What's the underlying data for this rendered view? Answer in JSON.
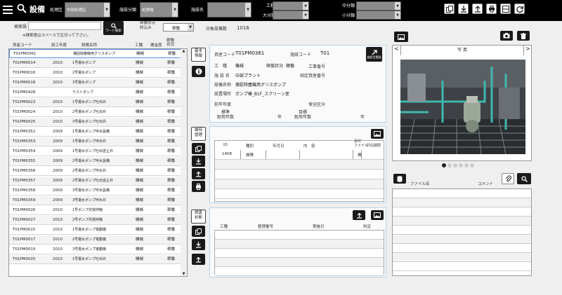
{
  "header": {
    "title": "設備",
    "area_label": "処理区",
    "area_value": "中部処理区",
    "facility_class_label": "施設分類",
    "facility_class_value": "処理場",
    "facility_name_label": "施設名",
    "facility_name_value": "",
    "work_type_label": "工種",
    "major_label": "大分類",
    "mid_label": "中分類",
    "minor_label": "小分類"
  },
  "search": {
    "label": "検索語",
    "placeholder": "",
    "hint": "※検索語はスペースで区切って下さい。",
    "word_search": "ワード検索",
    "status_filter_label": "稼働状況\n絞込み",
    "status_filter_value": "稼働",
    "count_label": "対象設備数",
    "count": "1016"
  },
  "list": {
    "headers": [
      "資産コード",
      "設工年度",
      "設備名称",
      "工種",
      "建金度",
      "稼働状況"
    ],
    "rows": [
      [
        "T01PM0361",
        "",
        "捕捉除塵機用グリスポンプ",
        "機械",
        "",
        "稼働"
      ],
      [
        "T01PM0014",
        "2010",
        "1号揚水ポンプ",
        "機械",
        "",
        "稼働"
      ],
      [
        "T01PM0016",
        "2010",
        "2号揚水ポンプ",
        "機械",
        "",
        "稼働"
      ],
      [
        "T01PM0018",
        "2010",
        "3号揚水ポンプ",
        "機械",
        "",
        "稼働"
      ],
      [
        "T01PM0428",
        "",
        "テストポンプ",
        "機械",
        "",
        "稼働"
      ],
      [
        "T01PM0023",
        "2010",
        "1号揚水ポンプ吐出弁",
        "機械",
        "",
        "稼働"
      ],
      [
        "T01PM0024",
        "2010",
        "2号揚水ポンプ吐出弁",
        "機械",
        "",
        "稼働"
      ],
      [
        "T01PM0025",
        "2010",
        "3号揚水ポンプ吐出弁",
        "機械",
        "",
        "稼働"
      ],
      [
        "T01PM0352",
        "2009",
        "1号揚水ポンプ呼水設備",
        "機械",
        "",
        "稼働"
      ],
      [
        "T01PM0353",
        "2009",
        "1号揚水ポンプ呼水弁",
        "機械",
        "",
        "稼働"
      ],
      [
        "T01PM0354",
        "2009",
        "1号揚水ポンプ吐出逆止弁",
        "機械",
        "",
        "稼働"
      ],
      [
        "T01PM0355",
        "2009",
        "2号揚水ポンプ呼水設備",
        "機械",
        "",
        "稼働"
      ],
      [
        "T01PM0356",
        "2009",
        "2号揚水ポンプ呼水弁",
        "機械",
        "",
        "稼働"
      ],
      [
        "T01PM0357",
        "2009",
        "2号揚水ポンプ吐出逆止弁",
        "機械",
        "",
        "稼働"
      ],
      [
        "T01PM0358",
        "2009",
        "3号揚水ポンプ呼水設備",
        "機械",
        "",
        "稼働"
      ],
      [
        "T01PM0359",
        "2009",
        "3号揚水ポンプ呼水弁",
        "機械",
        "",
        "稼働"
      ],
      [
        "T01PM0026",
        "2010",
        "1号ポンプ井撹拌機",
        "機械",
        "",
        "稼働"
      ],
      [
        "T01PM0027",
        "2010",
        "2号ポンプ井撹拌機",
        "機械",
        "",
        "稼働"
      ],
      [
        "T01PM0015",
        "2010",
        "1号揚水ポンプ電動機",
        "機械",
        "",
        "稼働"
      ],
      [
        "T01PM0017",
        "2010",
        "2号揚水ポンプ電動機",
        "機械",
        "",
        "稼働"
      ],
      [
        "T01PM0019",
        "2010",
        "3号揚水ポンプ電動機",
        "機械",
        "",
        "稼働"
      ],
      [
        "T01PM0020",
        "2010",
        "1号揚水ポンプ吐出弁",
        "機械",
        "",
        "稼働"
      ]
    ]
  },
  "side_tabs": {
    "basic": "基本\n情報",
    "maint": "維持\n管理",
    "survey": "調査\n診断"
  },
  "detail": {
    "asset_code_label": "資産コード",
    "asset_code": "T01PM0361",
    "facility_code_label": "施設コード",
    "facility_code": "T01",
    "map_btn": "施設位置図",
    "work_label": "工　種",
    "work": "機械",
    "status_label": "稼働状況",
    "status": "稼働",
    "construction_no_label": "工事番号",
    "construction_no": "",
    "facility_name_label": "施 設 名",
    "facility_name": "中部プラント",
    "fixed_asset_label": "固定資産番号",
    "fixed_asset": "",
    "equip_name_label": "設備名称",
    "equip_name": "捕捉除塵機用グリスポンプ",
    "location_label": "設置場所",
    "location": "ポンプ棟_B1F_スクリーン室",
    "prev_year_label": "前年年度",
    "prev_year": "",
    "maint_class_label": "保全区分",
    "maint_class": "",
    "std_life_label": "標準\n耐用年数",
    "std_life_unit": "年",
    "target_life_label": "目標\n耐用年数",
    "target_life_unit": "年"
  },
  "maint_table": {
    "headers": [
      "ID",
      "種別",
      "年月日",
      "内　容",
      "添付\nファイル",
      "対応期限"
    ],
    "rows": [
      [
        "1408",
        "故障",
        "",
        "",
        "無",
        ""
      ]
    ]
  },
  "survey_table": {
    "headers": [
      "工種",
      "整理番号",
      "実施日",
      "判定"
    ]
  },
  "photo": {
    "title": "写 真",
    "prev": "<",
    "next": ">"
  },
  "files": {
    "filename_label": "ファイル名",
    "comment_label": "コメント"
  }
}
